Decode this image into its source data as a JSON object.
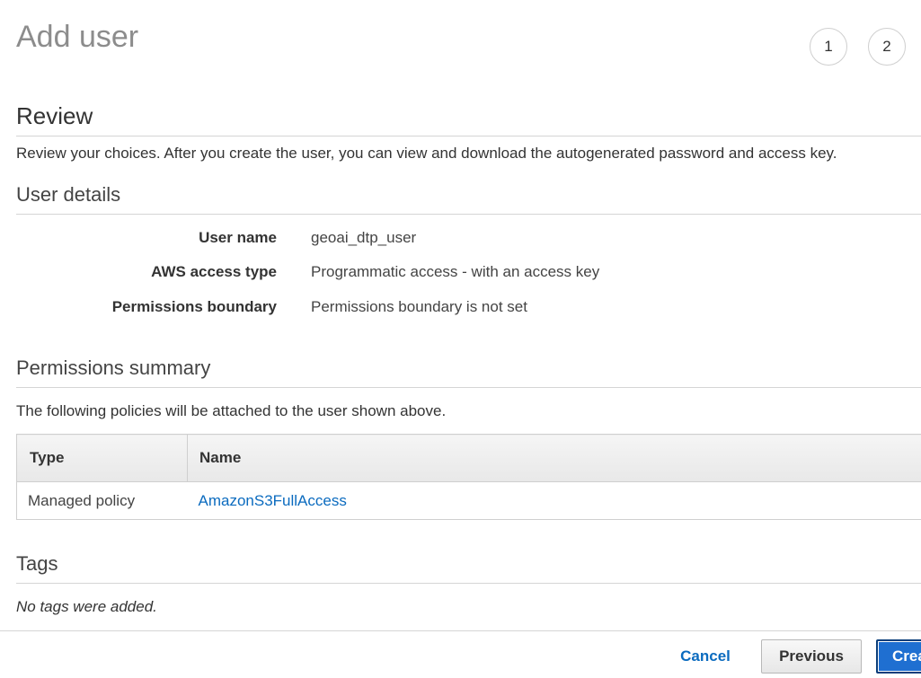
{
  "header": {
    "title": "Add user",
    "steps": [
      "1",
      "2"
    ]
  },
  "review": {
    "title": "Review",
    "description": "Review your choices. After you create the user, you can view and download the autogenerated password and access key."
  },
  "user_details": {
    "title": "User details",
    "rows": [
      {
        "label": "User name",
        "value": "geoai_dtp_user"
      },
      {
        "label": "AWS access type",
        "value": "Programmatic access - with an access key"
      },
      {
        "label": "Permissions boundary",
        "value": "Permissions boundary is not set"
      }
    ]
  },
  "permissions": {
    "title": "Permissions summary",
    "description": "The following policies will be attached to the user shown above.",
    "columns": [
      "Type",
      "Name"
    ],
    "rows": [
      {
        "type": "Managed policy",
        "name": "AmazonS3FullAccess"
      }
    ]
  },
  "tags": {
    "title": "Tags",
    "empty_text": "No tags were added."
  },
  "footer": {
    "cancel_label": "Cancel",
    "previous_label": "Previous",
    "create_label": "Create user"
  },
  "colors": {
    "link": "#0b6bbf",
    "primary_button": "#1f6fd1"
  }
}
